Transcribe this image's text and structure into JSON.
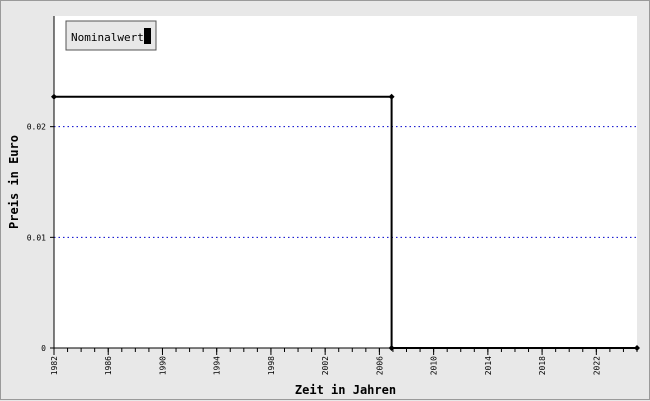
{
  "chart_data": {
    "type": "line",
    "title": "",
    "xlabel": "Zeit in Jahren",
    "ylabel": "Preis in Euro",
    "xlim": [
      1982,
      2025
    ],
    "ylim": [
      0,
      0.03
    ],
    "x_ticks": [
      "1982",
      "1986",
      "1990",
      "1994",
      "1998",
      "2002",
      "2006",
      "2010",
      "2014",
      "2018",
      "2022"
    ],
    "y_ticks": [
      "0",
      "0.01",
      "0.02"
    ],
    "grid": "horizontal dotted",
    "legend_position": "top-left",
    "series": [
      {
        "name": "Nominalwert",
        "color": "#000000",
        "step": true,
        "points": [
          {
            "x": 1982,
            "y": 0.0227
          },
          {
            "x": 2006.9,
            "y": 0.0227
          },
          {
            "x": 2006.9,
            "y": 0
          },
          {
            "x": 2025,
            "y": 0
          }
        ]
      }
    ],
    "colors": {
      "plot_background": "#ffffff",
      "frame_background": "#e8e8e8",
      "gridline": "#0000cc"
    }
  }
}
